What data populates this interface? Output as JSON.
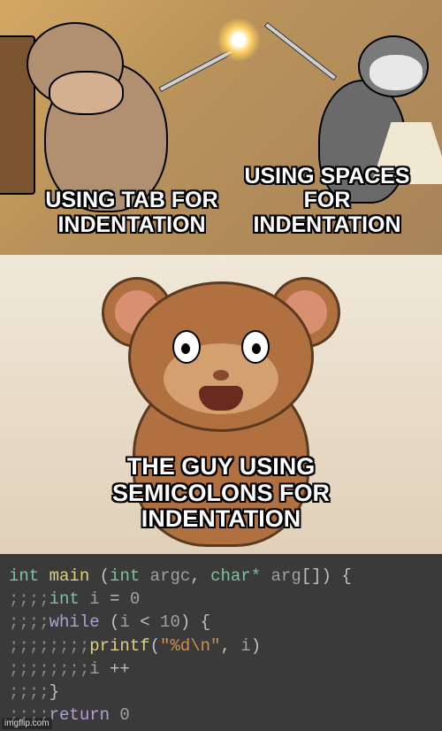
{
  "meme": {
    "top_left_text": "USING TAB FOR INDENTATION",
    "top_right_text": "USING SPACES FOR INDENTATION",
    "mid_text": "THE GUY USING SEMICOLONS FOR INDENTATION"
  },
  "code": {
    "lines": [
      "int main (int argc, char* arg[]) {",
      ";;;;int i = 0",
      ";;;;while (i < 10) {",
      ";;;;;;;;printf(\"%d\\n\", i)",
      ";;;;;;;;i ++",
      ";;;;}",
      ";;;;return 0"
    ]
  },
  "watermark": "imgflip.com"
}
